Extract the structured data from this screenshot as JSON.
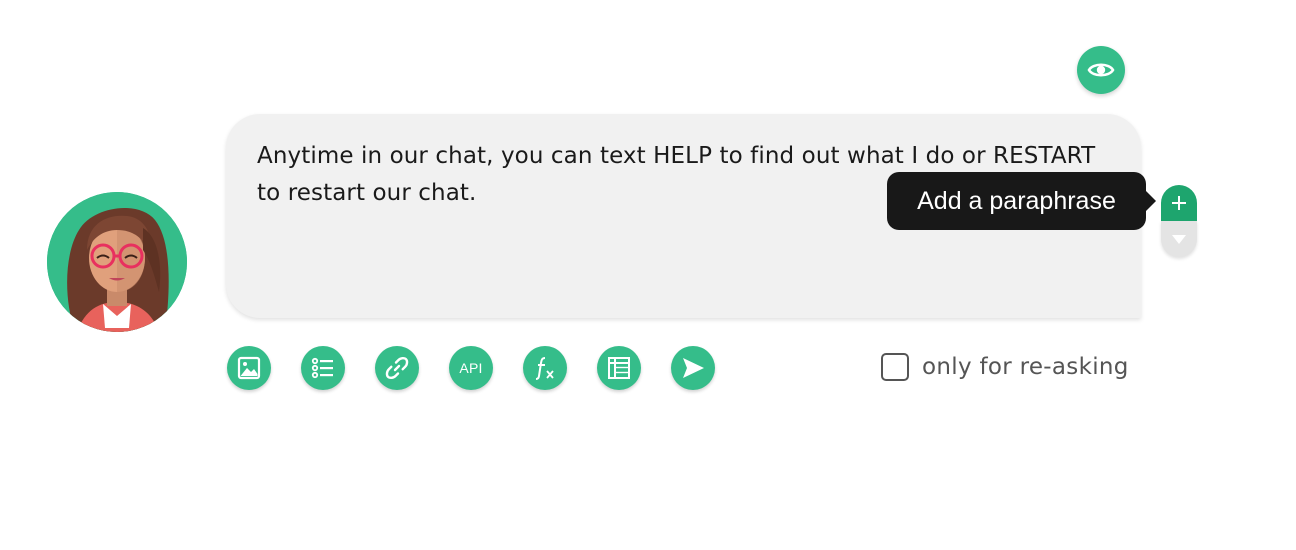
{
  "preview": {
    "icon": "eye-icon"
  },
  "avatar": {
    "icon": "bot-avatar"
  },
  "message": {
    "text": "Anytime in our chat, you can text HELP to find out what I do or RESTART to restart our chat."
  },
  "tooltip": {
    "text": "Add a paraphrase"
  },
  "side_controls": {
    "add_icon": "plus-icon",
    "expand_icon": "caret-down-icon"
  },
  "toolbar": {
    "tools": [
      {
        "name": "image",
        "icon": "image-icon"
      },
      {
        "name": "list",
        "icon": "list-icon"
      },
      {
        "name": "link",
        "icon": "link-icon"
      },
      {
        "name": "api",
        "icon": "api-icon",
        "label": "API"
      },
      {
        "name": "function",
        "icon": "function-icon"
      },
      {
        "name": "table",
        "icon": "table-icon"
      },
      {
        "name": "send",
        "icon": "send-icon"
      }
    ]
  },
  "reask": {
    "checked": false,
    "label": "only for re-asking"
  },
  "colors": {
    "accent": "#35bd8a",
    "accent_dark": "#1ea56e",
    "bubble_bg": "#f1f1f1",
    "tooltip_bg": "#181818"
  }
}
